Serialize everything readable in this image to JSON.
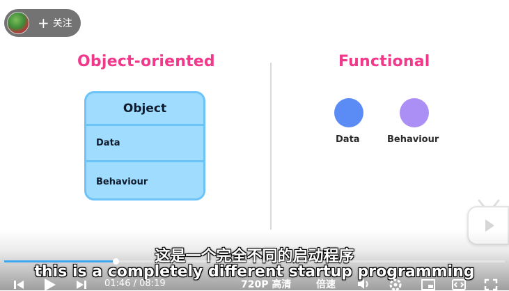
{
  "follow": {
    "plus": "+",
    "label": "关注"
  },
  "slide": {
    "oo_heading": "Object-oriented",
    "fn_heading": "Functional",
    "object": {
      "title": "Object",
      "rows": [
        "Data",
        "Behaviour"
      ]
    },
    "functional": {
      "data_label": "Data",
      "behaviour_label": "Behaviour"
    }
  },
  "subtitles": {
    "cn": "这是一个完全不同的启动程序",
    "en": "this is a completely different startup programming"
  },
  "player": {
    "current_time": "01:46",
    "separator": "/",
    "duration": "08:19",
    "progress_percent": 22.3,
    "quality": "720P",
    "quality_label": "高清",
    "speed_label": "倍速"
  },
  "colors": {
    "heading": "#f0398b",
    "card_fill": "#9fdcfd",
    "card_border": "#6cc3f7",
    "data_circle": "#5b8cf5",
    "behaviour_circle": "#ab8ff5",
    "progress": "#3aa8f0"
  },
  "icons": [
    "previous-icon",
    "play-icon",
    "next-icon",
    "volume-icon",
    "settings-icon",
    "picture-in-picture-icon",
    "widescreen-icon",
    "fullscreen-icon",
    "tv-icon"
  ]
}
